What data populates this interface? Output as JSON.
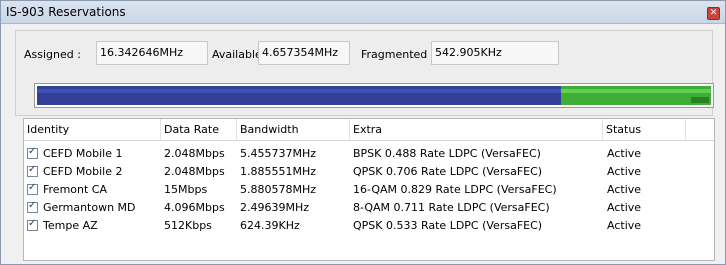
{
  "window": {
    "title": "IS-903 Reservations",
    "close_icon": "close-icon"
  },
  "summary": {
    "assigned_label": "Assigned :",
    "assigned_value": "16.342646MHz",
    "available_label": "Available :",
    "available_value": "4.657354MHz",
    "fragmented_label": "Fragmented :",
    "fragmented_value": "542.905KHz"
  },
  "usage_bar": {
    "assigned_fraction": 0.778,
    "available_fraction": 0.222,
    "fragmented_fraction": 0.026,
    "colors": {
      "assigned": "#334097",
      "available": "#3fae35",
      "fragmented": "#2b7f25"
    }
  },
  "table": {
    "headers": [
      "Identity",
      "Data Rate",
      "Bandwidth",
      "Extra",
      "Status"
    ],
    "rows": [
      {
        "checked": true,
        "identity": "CEFD Mobile 1",
        "data_rate": "2.048Mbps",
        "bandwidth": "5.455737MHz",
        "extra": "BPSK 0.488 Rate  LDPC (VersaFEC)",
        "status": "Active"
      },
      {
        "checked": true,
        "identity": "CEFD Mobile 2",
        "data_rate": "2.048Mbps",
        "bandwidth": "1.885551MHz",
        "extra": "QPSK 0.706 Rate  LDPC (VersaFEC)",
        "status": "Active"
      },
      {
        "checked": true,
        "identity": "Fremont CA",
        "data_rate": "15Mbps",
        "bandwidth": "5.880578MHz",
        "extra": "16-QAM 0.829 Rate  LDPC (VersaFEC)",
        "status": "Active"
      },
      {
        "checked": true,
        "identity": "Germantown MD",
        "data_rate": "4.096Mbps",
        "bandwidth": "2.49639MHz",
        "extra": "8-QAM 0.711 Rate  LDPC (VersaFEC)",
        "status": "Active"
      },
      {
        "checked": true,
        "identity": "Tempe AZ",
        "data_rate": "512Kbps",
        "bandwidth": "624.39KHz",
        "extra": "QPSK 0.533 Rate  LDPC (VersaFEC)",
        "status": "Active"
      }
    ]
  }
}
